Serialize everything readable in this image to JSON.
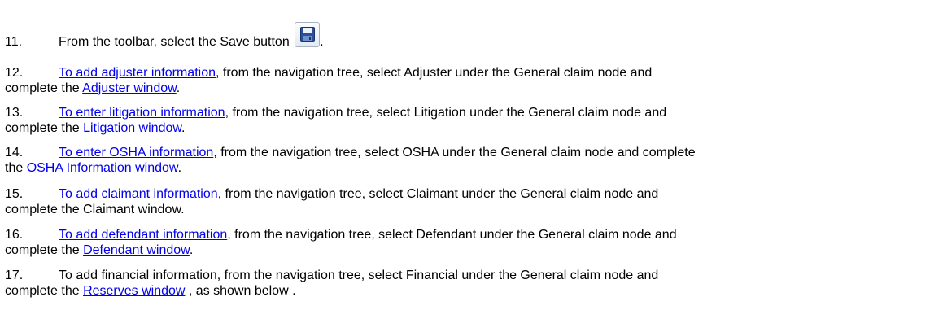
{
  "steps": [
    {
      "number": "11.",
      "text_before_button": "From the toolbar, select the Save button",
      "text_after_button": "."
    },
    {
      "number": "12.",
      "link": "To add adjuster information",
      "line1_rest": ", from the navigation tree, select Adjuster under the General claim node and",
      "line2_before": "complete the ",
      "line2_link": "Adjuster window",
      "line2_after": "."
    },
    {
      "number": "13.",
      "link": "To enter litigation information",
      "line1_rest": ", from the navigation tree, select Litigation under the General claim node and",
      "line2_before": "complete the ",
      "line2_link": "Litigation window",
      "line2_after": "."
    },
    {
      "number": "14.",
      "link": "To enter OSHA information",
      "line1_rest": ", from the navigation tree, select OSHA under the General claim node and complete",
      "line2_before": "the ",
      "line2_link": "OSHA Information window",
      "line2_after": "."
    },
    {
      "number": "15.",
      "link": "To add claimant information",
      "line1_rest": ", from the navigation tree, select Claimant under the General claim node and",
      "line2_text": "complete the Claimant window."
    },
    {
      "number": "16.",
      "link": "To add defendant information",
      "line1_rest": ", from the navigation tree, select Defendant under the General claim node and",
      "line2_before": "complete the ",
      "line2_link": "Defendant window",
      "line2_after": "."
    },
    {
      "number": "17.",
      "line1_text": "To add financial information, from the navigation tree, select Financial under the General claim node and",
      "line2_before": "complete the ",
      "line2_link": "Reserves window",
      "line2_after": " , as shown below ."
    }
  ],
  "icons": {
    "save": "floppy-disk-icon"
  },
  "colors": {
    "link": "#0000ee",
    "text": "#000000"
  }
}
